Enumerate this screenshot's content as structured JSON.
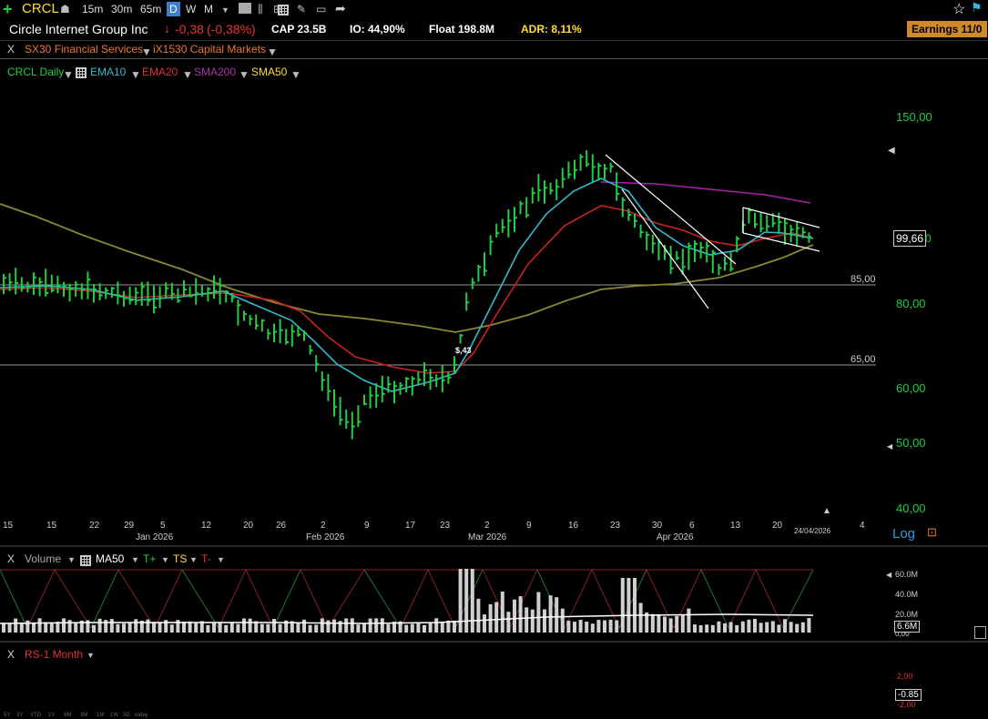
{
  "toolbar": {
    "symbol": "CRCL",
    "intervals": [
      "15m",
      "30m",
      "65m",
      "D",
      "W",
      "M"
    ],
    "active_interval": "D"
  },
  "header": {
    "company": "Circle Internet Group Inc",
    "change": "-0,38",
    "change_pct": "(-0,38%)",
    "cap": "CAP 23.5B",
    "io": "IO: 44,90%",
    "float": "Float 198.8M",
    "adr": "ADR: 8,11%",
    "earnings": "Earnings 11/0"
  },
  "groups": {
    "close": "X",
    "sector": "SX30 Financial Services",
    "industry": "iX1530 Capital Markets"
  },
  "indicators": {
    "series": "CRCL Daily",
    "ema10": "EMA10",
    "ema20": "EMA20",
    "sma200": "SMA200",
    "sma50": "SMA50"
  },
  "price_axis": {
    "labels": [
      "150,00",
      "80,00",
      "60,00",
      "50,00",
      "40,00"
    ],
    "current": "99,66",
    "current_suffix": "0",
    "log": "Log"
  },
  "levels": [
    {
      "label": "85,00",
      "value": 85
    },
    {
      "label": "65,00",
      "value": 65
    }
  ],
  "annotation": "$,43",
  "date_axis": {
    "days": [
      "15",
      "22",
      "29",
      "5",
      "12",
      "20",
      "26",
      "2",
      "9",
      "17",
      "23",
      "2",
      "9",
      "16",
      "23",
      "30",
      "6",
      "13",
      "20",
      "4"
    ],
    "months": [
      "Jan 2026",
      "Feb 2026",
      "Mar 2026",
      "Apr 2026"
    ],
    "cursor_date": "24/04/2026",
    "left_stub": "15"
  },
  "volume_pane": {
    "close": "X",
    "title": "Volume",
    "ma": "MA50",
    "t_plus": "T+",
    "ts": "TS",
    "t_minus": "T-",
    "labels": [
      "60.0M",
      "40.0M",
      "20.0M",
      "0,00"
    ],
    "current": "6.6M"
  },
  "rs_pane": {
    "close": "X",
    "title": "RS-1 Month",
    "labels": [
      "2,00",
      "-2,00"
    ],
    "current": "-0.85"
  },
  "bottom_ranges": [
    "5Y",
    "3Y",
    "YTD",
    "1Y",
    "6M",
    "3M",
    "1M",
    "1W",
    "3D",
    "today"
  ],
  "colors": {
    "up": "#22cc44",
    "ema10": "#33bbcc",
    "ema20": "#cc2222",
    "sma200": "#aa22aa",
    "sma50": "#888833",
    "accent_yellow": "#ffdd33",
    "earnings_bg": "#d08a2a"
  }
}
